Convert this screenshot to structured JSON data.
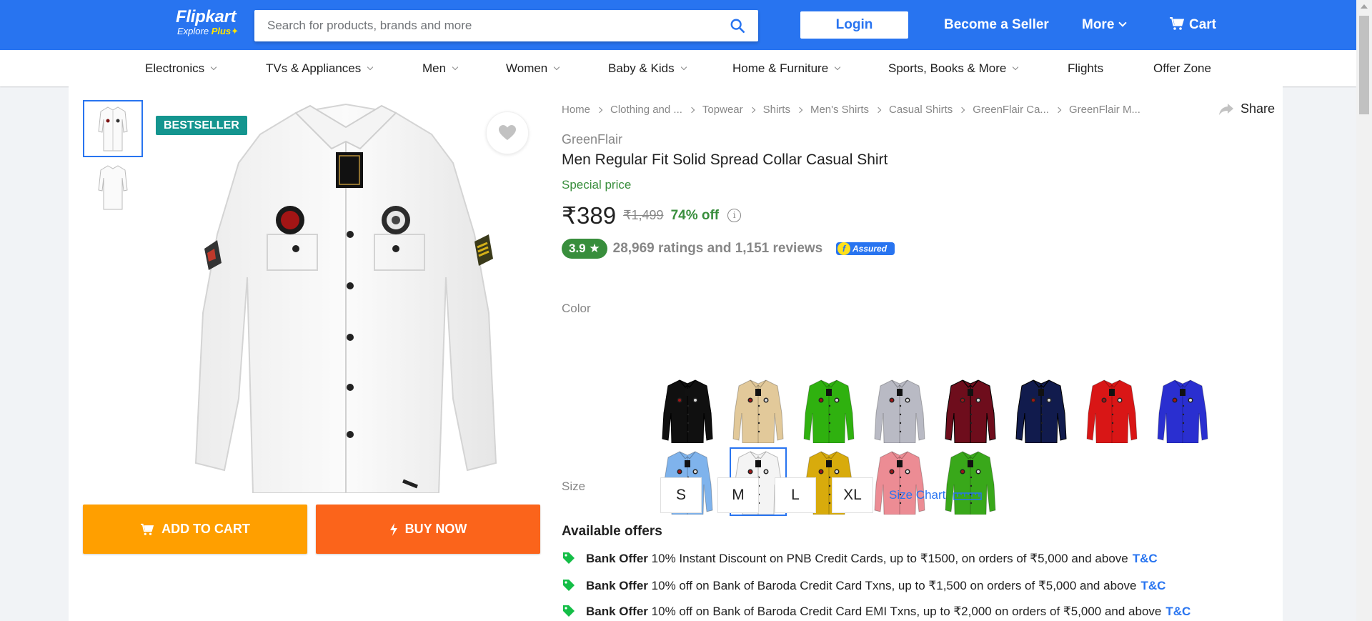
{
  "header": {
    "logo_main": "Flipkart",
    "logo_sub": "Explore",
    "logo_plus": "Plus",
    "search_placeholder": "Search for products, brands and more",
    "login": "Login",
    "seller": "Become a Seller",
    "more": "More",
    "cart": "Cart",
    "brand_color": "#2874f0"
  },
  "categories": [
    "Electronics",
    "TVs & Appliances",
    "Men",
    "Women",
    "Baby & Kids",
    "Home & Furniture",
    "Sports, Books & More",
    "Flights",
    "Offer Zone"
  ],
  "product": {
    "badge": "BESTSELLER",
    "breadcrumbs": [
      "Home",
      "Clothing and ...",
      "Topwear",
      "Shirts",
      "Men's Shirts",
      "Casual Shirts",
      "GreenFlair Ca...",
      "GreenFlair M..."
    ],
    "share": "Share",
    "brand": "GreenFlair",
    "title": "Men Regular Fit Solid Spread Collar Casual Shirt",
    "special": "Special price",
    "price": "₹389",
    "mrp": "₹1,499",
    "discount": "74% off",
    "rating": "3.9",
    "ratings_text": "28,969 ratings and 1,151 reviews",
    "assured": "Assured",
    "color_label": "Color",
    "colors": [
      "#101010",
      "#e2c99a",
      "#2fb10f",
      "#b9bac4",
      "#6e0d1c",
      "#111b4d",
      "#d91616",
      "#2a2fd0",
      "#7fb3ec",
      "#f4f4f4",
      "#d8ab0c",
      "#ec8c94",
      "#39a81a"
    ],
    "selected_color_index": 9,
    "size_label": "Size",
    "sizes": [
      "S",
      "M",
      "L",
      "XL"
    ],
    "size_chart": "Size Chart",
    "add_to_cart": "ADD TO CART",
    "buy_now": "BUY NOW"
  },
  "offers": {
    "title": "Available offers",
    "items": [
      {
        "type": "Bank Offer",
        "text": "10% Instant Discount on PNB Credit Cards, up to ₹1500, on orders of ₹5,000 and above",
        "link": "T&C"
      },
      {
        "type": "Bank Offer",
        "text": "10% off on Bank of Baroda Credit Card Txns, up to ₹1,500 on orders of ₹5,000 and above",
        "link": "T&C"
      },
      {
        "type": "Bank Offer",
        "text": "10% off on Bank of Baroda Credit Card EMI Txns, up to ₹2,000 on orders of ₹5,000 and above",
        "link": "T&C"
      }
    ]
  }
}
